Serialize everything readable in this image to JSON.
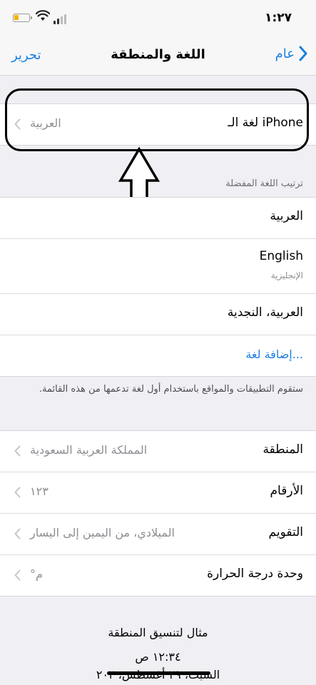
{
  "status_bar": {
    "time": "١:٢٧"
  },
  "nav": {
    "title": "اللغة والمنطقة",
    "back_label": "عام",
    "edit_label": "تحرير"
  },
  "iphone_language": {
    "label": "لغة الـ iPhone",
    "value": "العربية"
  },
  "preferred_order": {
    "header": "ترتيب اللغة المفضلة",
    "items": [
      {
        "label": "العربية"
      },
      {
        "label": "English",
        "sub": "الإنجليزية"
      },
      {
        "label": "العربية، النجدية"
      }
    ],
    "add_label": "إضافة لغة...",
    "footnote": "ستقوم التطبيقات والمواقع باستخدام أول لغة تدعمها من هذه القائمة."
  },
  "region_settings": [
    {
      "label": "المنطقة",
      "value": "المملكة العربية السعودية"
    },
    {
      "label": "الأرقام",
      "value": "١٢٣"
    },
    {
      "label": "التقويم",
      "value": "الميلادي، من اليمين إلى اليسار"
    },
    {
      "label": "وحدة درجة الحرارة",
      "value": "°م"
    }
  ],
  "example": {
    "title": "مثال لتنسيق المنطقة",
    "time": "١٢:٣٤ ص",
    "date": "السبت، ٢٩ أغسطس، ٢٠٢"
  },
  "colors": {
    "accent": "#1a7ee3",
    "background": "#efeff4",
    "secondary_text": "#8e8e93"
  }
}
